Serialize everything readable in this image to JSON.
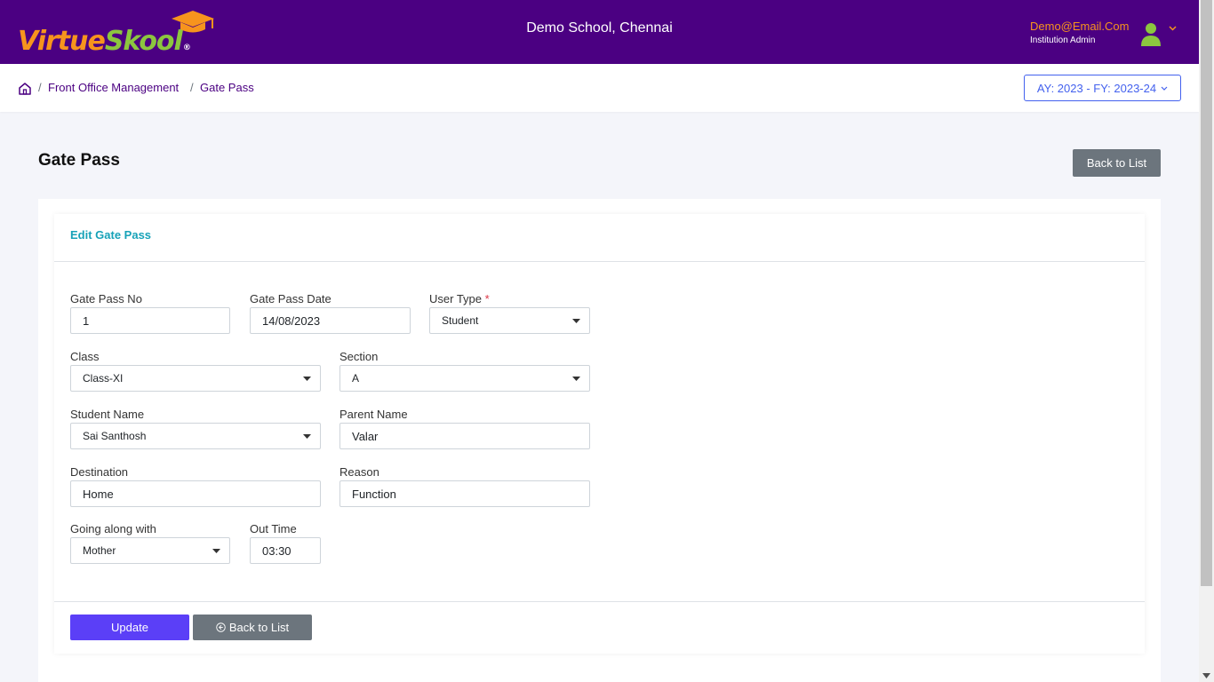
{
  "header": {
    "logo_part1": "Virtue",
    "logo_part2": "Skool",
    "logo_reg": "®",
    "school_name": "Demo School, Chennai",
    "user_email": "Demo@Email.Com",
    "user_role": "Institution Admin"
  },
  "breadcrumb": {
    "items": [
      "Front Office Management",
      "Gate Pass"
    ],
    "separator": "/"
  },
  "academic_year": "AY: 2023 - FY: 2023-24",
  "page": {
    "title": "Gate Pass",
    "back_button": "Back to List"
  },
  "form": {
    "title": "Edit Gate Pass",
    "gate_pass_no": {
      "label": "Gate Pass No",
      "value": "1"
    },
    "gate_pass_date": {
      "label": "Gate Pass Date",
      "value": "14/08/2023"
    },
    "user_type": {
      "label": "User Type",
      "required_mark": "*",
      "value": "Student"
    },
    "class": {
      "label": "Class",
      "value": "Class-XI"
    },
    "section": {
      "label": "Section",
      "value": "A"
    },
    "student_name": {
      "label": "Student Name",
      "value": "Sai Santhosh"
    },
    "parent_name": {
      "label": "Parent Name",
      "value": "Valar"
    },
    "destination": {
      "label": "Destination",
      "value": "Home"
    },
    "reason": {
      "label": "Reason",
      "value": "Function"
    },
    "going_along_with": {
      "label": "Going along with",
      "value": "Mother"
    },
    "out_time": {
      "label": "Out Time",
      "value": "03:30"
    },
    "update_button": "Update",
    "back_button": "Back to List"
  },
  "colors": {
    "header_bg": "#4b0082",
    "logo_orange": "#f7941d",
    "logo_green": "#8cc63f",
    "accent_blue": "#4361ee",
    "card_title": "#17a2b8",
    "update_button": "#5b3ff7",
    "secondary_button": "#6c757d"
  },
  "icons": [
    "graduation-cap-icon",
    "user-avatar-icon",
    "chevron-down-icon",
    "home-icon",
    "caret-down-icon",
    "circle-arrow-left-icon"
  ]
}
